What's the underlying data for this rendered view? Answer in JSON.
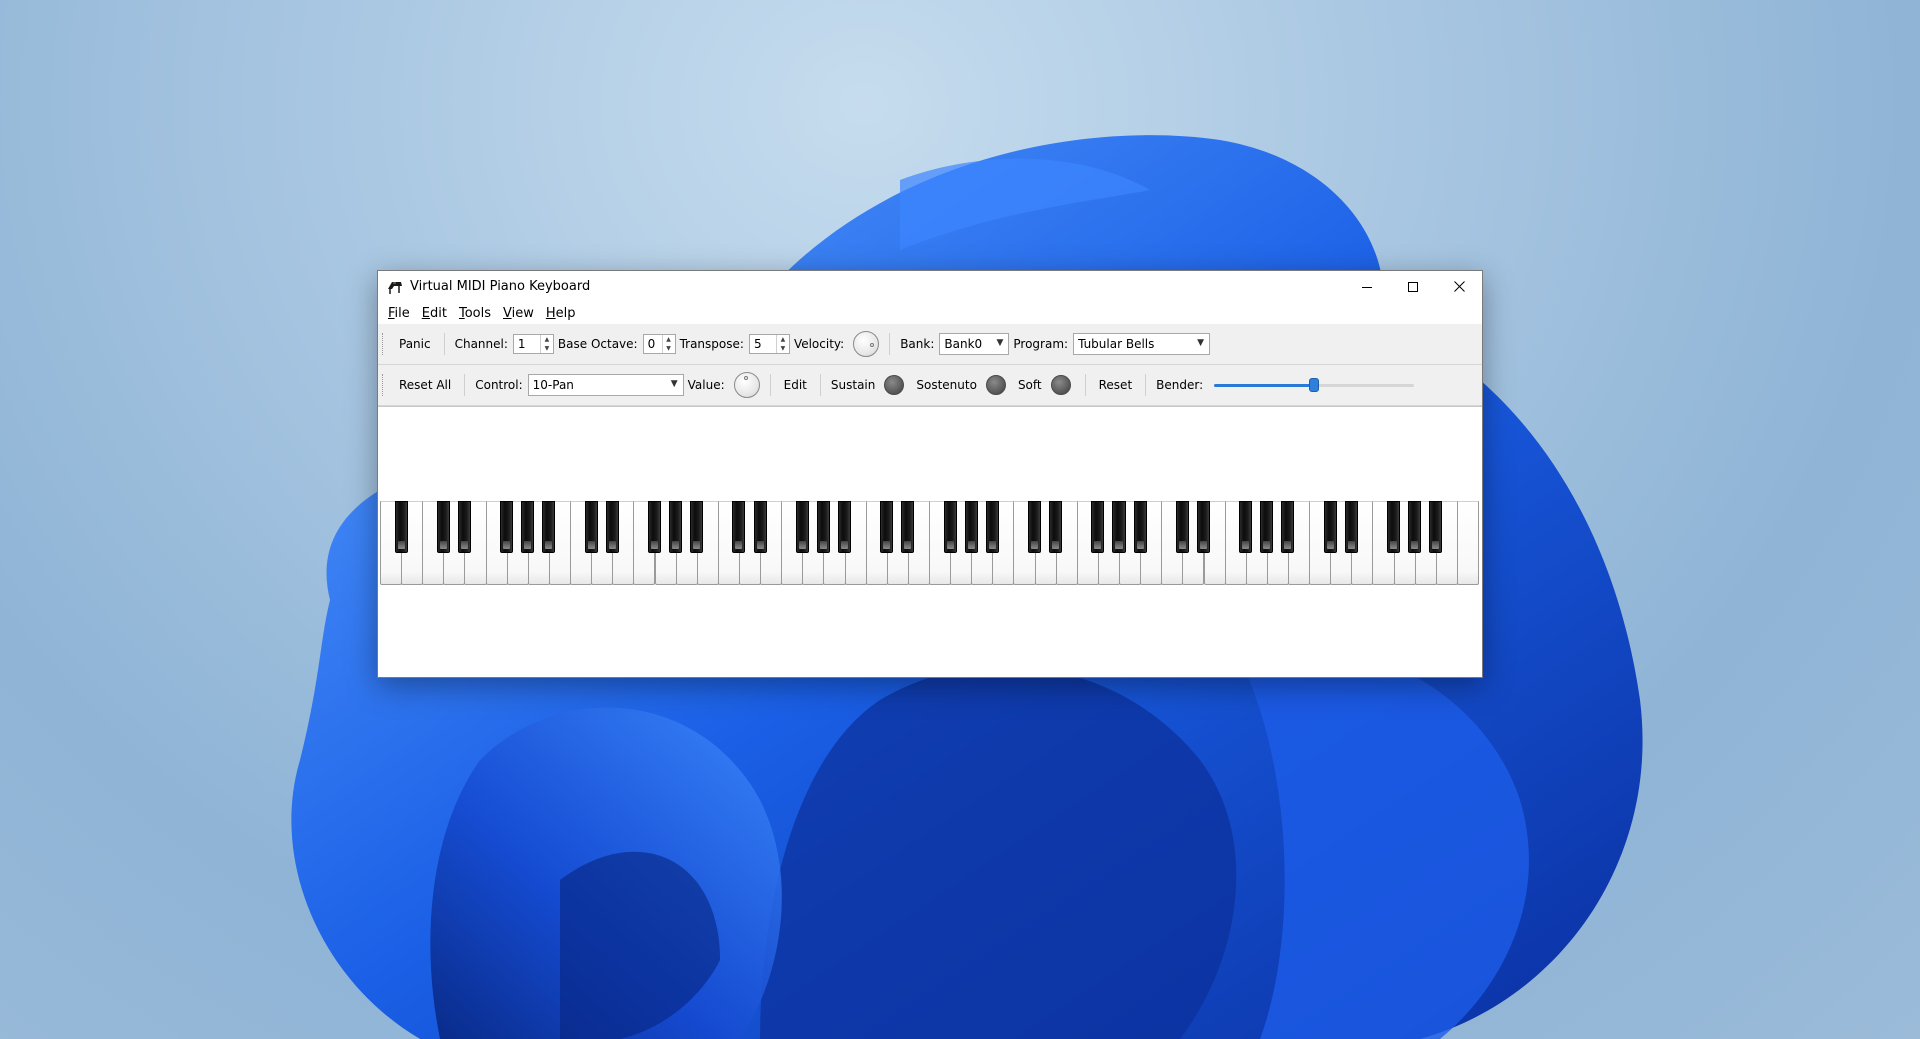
{
  "window": {
    "title": "Virtual MIDI Piano Keyboard",
    "icon": "piano-icon"
  },
  "menu": [
    {
      "accel": "F",
      "rest": "ile"
    },
    {
      "accel": "E",
      "rest": "dit"
    },
    {
      "accel": "T",
      "rest": "ools"
    },
    {
      "accel": "V",
      "rest": "iew"
    },
    {
      "accel": "H",
      "rest": "elp"
    }
  ],
  "toolbar1": {
    "panic_label": "Panic",
    "channel_label": "Channel:",
    "channel_value": "1",
    "base_octave_label": "Base Octave:",
    "base_octave_value": "0",
    "transpose_label": "Transpose:",
    "transpose_value": "5",
    "velocity_label": "Velocity:",
    "bank_label": "Bank:",
    "bank_value": "Bank0",
    "program_label": "Program:",
    "program_value": "Tubular Bells"
  },
  "toolbar2": {
    "reset_all_label": "Reset All",
    "control_label": "Control:",
    "control_value": "10-Pan",
    "value_label": "Value:",
    "edit_label": "Edit",
    "sustain_label": "Sustain",
    "sostenuto_label": "Sostenuto",
    "soft_label": "Soft",
    "reset_label": "Reset",
    "bender_label": "Bender:",
    "bender_position": 0.5
  },
  "keyboard": {
    "white_key_count": 52,
    "first_note": "A"
  },
  "colors": {
    "accent": "#2b79d6",
    "window_bg": "#f0f0f0",
    "led_off": "#5c5c5c"
  }
}
